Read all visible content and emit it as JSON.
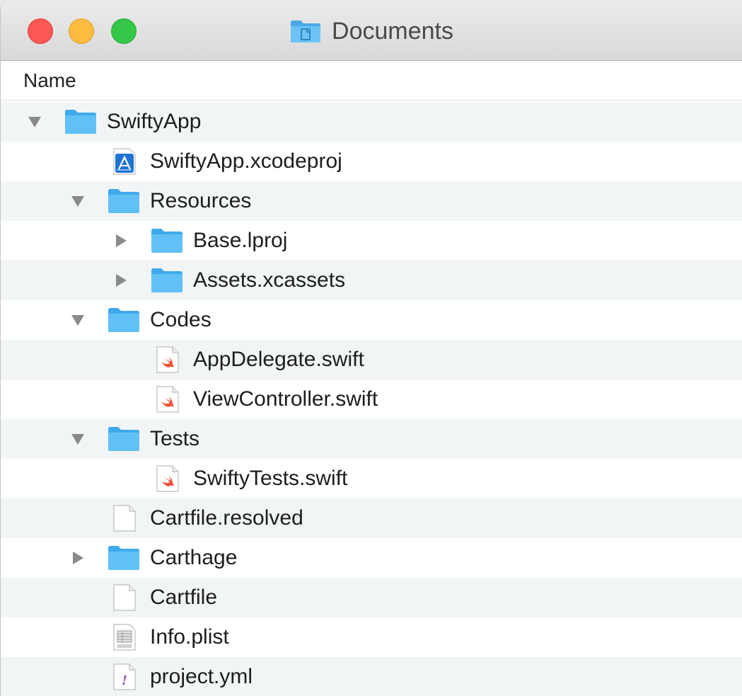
{
  "window": {
    "title": "Documents"
  },
  "column_header": {
    "name": "Name"
  },
  "rows": [
    {
      "label": "SwiftyApp",
      "icon": "folder-icon",
      "depth": 0,
      "disclosure": "expanded"
    },
    {
      "label": "SwiftyApp.xcodeproj",
      "icon": "xcodeproj-icon",
      "depth": 1,
      "disclosure": "none"
    },
    {
      "label": "Resources",
      "icon": "folder-icon",
      "depth": 1,
      "disclosure": "expanded"
    },
    {
      "label": "Base.lproj",
      "icon": "folder-icon",
      "depth": 2,
      "disclosure": "collapsed"
    },
    {
      "label": "Assets.xcassets",
      "icon": "folder-icon",
      "depth": 2,
      "disclosure": "collapsed"
    },
    {
      "label": "Codes",
      "icon": "folder-icon",
      "depth": 1,
      "disclosure": "expanded"
    },
    {
      "label": "AppDelegate.swift",
      "icon": "swift-file-icon",
      "depth": 2,
      "disclosure": "none"
    },
    {
      "label": "ViewController.swift",
      "icon": "swift-file-icon",
      "depth": 2,
      "disclosure": "none"
    },
    {
      "label": "Tests",
      "icon": "folder-icon",
      "depth": 1,
      "disclosure": "expanded"
    },
    {
      "label": "SwiftyTests.swift",
      "icon": "swift-file-icon",
      "depth": 2,
      "disclosure": "none"
    },
    {
      "label": "Cartfile.resolved",
      "icon": "blank-file-icon",
      "depth": 1,
      "disclosure": "none"
    },
    {
      "label": "Carthage",
      "icon": "folder-icon",
      "depth": 1,
      "disclosure": "collapsed"
    },
    {
      "label": "Cartfile",
      "icon": "blank-file-icon",
      "depth": 1,
      "disclosure": "none"
    },
    {
      "label": "Info.plist",
      "icon": "plist-file-icon",
      "depth": 1,
      "disclosure": "none"
    },
    {
      "label": "project.yml",
      "icon": "yaml-file-icon",
      "depth": 1,
      "disclosure": "none"
    }
  ],
  "colors": {
    "folder": "#5ec0f5",
    "row_alt": "#f2f5f5",
    "swift": "#f05138"
  }
}
